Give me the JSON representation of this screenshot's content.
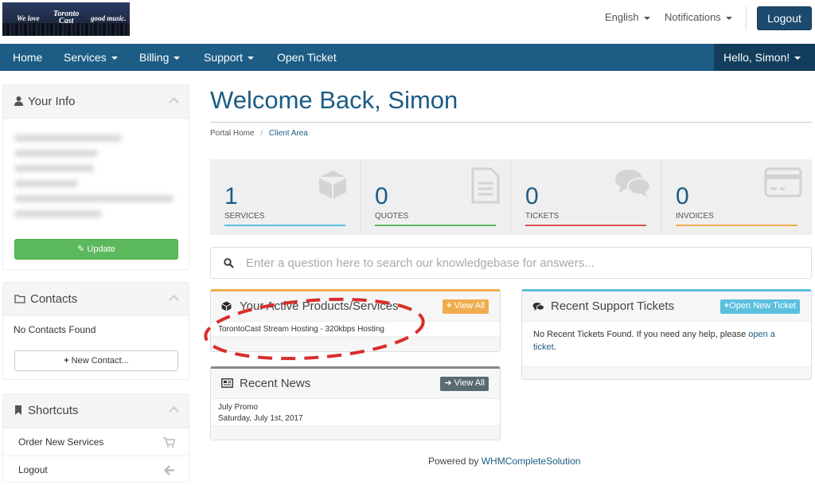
{
  "brand": {
    "logo_text_1": "We love",
    "logo_text_2a": "Toronto",
    "logo_text_2b": "Cast",
    "logo_text_3": "good music."
  },
  "header": {
    "language": "English",
    "notifications": "Notifications",
    "logout": "Logout"
  },
  "nav": {
    "home": "Home",
    "services": "Services",
    "billing": "Billing",
    "support": "Support",
    "open_ticket": "Open Ticket",
    "user": "Hello, Simon!"
  },
  "sidebar": {
    "your_info": {
      "title": "Your Info",
      "update": "Update"
    },
    "contacts": {
      "title": "Contacts",
      "empty": "No Contacts Found",
      "new": "New Contact..."
    },
    "shortcuts": {
      "title": "Shortcuts",
      "items": [
        {
          "label": "Order New Services",
          "icon": "cart-icon"
        },
        {
          "label": "Logout",
          "icon": "arrow-left-icon"
        }
      ]
    }
  },
  "main": {
    "welcome": "Welcome Back, Simon",
    "breadcrumb": {
      "home": "Portal Home",
      "sep": "/",
      "current": "Client Area"
    },
    "stats": [
      {
        "value": "1",
        "label": "SERVICES",
        "color": "#5bc0de",
        "icon": "cube-icon"
      },
      {
        "value": "0",
        "label": "QUOTES",
        "color": "#5cb85c",
        "icon": "document-icon"
      },
      {
        "value": "0",
        "label": "TICKETS",
        "color": "#d9534f",
        "icon": "chat-icon"
      },
      {
        "value": "0",
        "label": "INVOICES",
        "color": "#f0ad4e",
        "icon": "credit-card-icon"
      }
    ],
    "kb_search": {
      "placeholder": "Enter a question here to search our knowledgebase for answers..."
    },
    "products": {
      "title": "Your Active Products/Services",
      "view_all": "View All",
      "items": [
        "TorontoCast Stream Hosting - 320kbps Hosting"
      ]
    },
    "tickets": {
      "title": "Recent Support Tickets",
      "open_new": "Open New Ticket",
      "empty_text": "No Recent Tickets Found. If you need any help, please",
      "link": "open a ticket",
      "period": "."
    },
    "news": {
      "title": "Recent News",
      "view_all": "View All",
      "items": [
        {
          "title": "July Promo",
          "date": "Saturday, July 1st, 2017"
        }
      ]
    }
  },
  "footer": {
    "powered_by": "Powered by",
    "brand": "WHMCompleteSolution"
  }
}
